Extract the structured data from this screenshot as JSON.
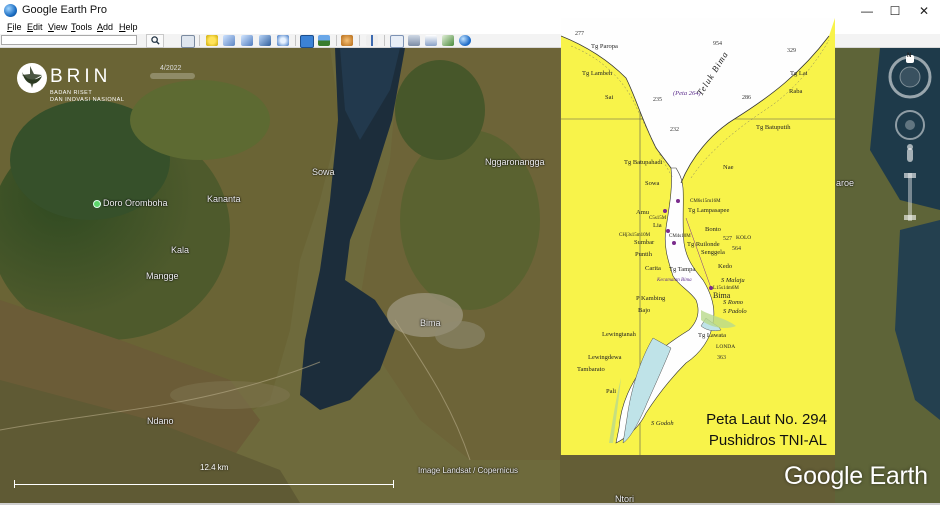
{
  "window": {
    "title": "Google Earth Pro",
    "minimize": "—",
    "maximize": "☐",
    "close": "✕"
  },
  "menu": [
    {
      "label": "File",
      "key": "F",
      "rest": "ile"
    },
    {
      "label": "Edit",
      "key": "E",
      "rest": "dit"
    },
    {
      "label": "View",
      "key": "V",
      "rest": "iew"
    },
    {
      "label": "Tools",
      "key": "T",
      "rest": "ools"
    },
    {
      "label": "Add",
      "key": "A",
      "rest": "dd"
    },
    {
      "label": "Help",
      "key": "H",
      "rest": "elp"
    }
  ],
  "search": {
    "value": "",
    "button_icon": "search-icon"
  },
  "toolbar_icons": [
    "sidebar-icon",
    "placemark-icon",
    "polygon-icon",
    "path-icon",
    "image-overlay-icon",
    "tour-icon",
    "historical-imagery-icon",
    "sun-icon",
    "planets-icon",
    "ruler-icon",
    "email-icon",
    "print-icon",
    "save-image-icon",
    "google-maps-icon",
    "earth-icon"
  ],
  "map": {
    "logo": {
      "name": "BRIN",
      "line1": "BADAN RISET",
      "line2": "DAN INOVASI NASIONAL"
    },
    "historical_date": "4/2022",
    "places": [
      {
        "id": "doro",
        "text": "Doro Oromboha"
      },
      {
        "id": "kananta",
        "text": "Kananta"
      },
      {
        "id": "kala",
        "text": "Kala"
      },
      {
        "id": "mangge",
        "text": "Mangge"
      },
      {
        "id": "sowa",
        "text": "Sowa"
      },
      {
        "id": "nggaronangga",
        "text": "Nggaronangga"
      },
      {
        "id": "bima",
        "text": "Bima"
      },
      {
        "id": "ndano",
        "text": "Ndano"
      },
      {
        "id": "karoe",
        "text": "aroe"
      },
      {
        "id": "ntori",
        "text": "Ntori"
      }
    ],
    "scale": "12.4 km",
    "attribution": "Image Landsat / Copernicus",
    "brand": "Google Earth"
  },
  "overlay": {
    "caption_line1": "Peta Laut No. 294",
    "caption_line2": "Pushidros TNI-AL",
    "labels": {
      "tg_paropa": "Tg Paropa",
      "tg_lambeh": "Tg Lambeh",
      "sai": "Sai",
      "peta264": "(Peta 264)",
      "teluk_bima": "Teluk Bima",
      "tg_lai": "Tg Lai",
      "raba": "Raba",
      "tg_batuputih": "Tg Batuputih",
      "tg_batupahadi": "Tg Batupahadi",
      "nae": "Nae",
      "sowa": "Sowa",
      "amu": "Amu",
      "tg_lampasapee": "Tg Lampasapee",
      "lia": "Lia",
      "bonto": "Bonto",
      "sumbar": "Sumbar",
      "kolo": "KOLO",
      "tg_ruilonde": "Tg Ruilonde",
      "senggela": "Senggela",
      "puntih": "Puntih",
      "carita": "Carita",
      "tg_tampa": "Tg Tampa",
      "kedo": "Kedo",
      "s_malaju": "S Malaju",
      "bima": "Bima",
      "p_kambing": "P Kambing",
      "bajo": "Bajo",
      "s_romo": "S Romo",
      "s_padolo": "S Padolo",
      "lewingtanah": "Lewingtanah",
      "tg_lawata": "Tg Lawata",
      "londa": "LONDA",
      "lewingdewa": "Lewingdewa",
      "tambarato": "Tambarato",
      "pali": "Pali",
      "s_godoh": "S Godoh",
      "cm6": "CM6s15m16M",
      "c5s15m": "C5s15M",
      "cm4": "CM4s10M",
      "chj": "CHj3s15m10M",
      "light_bima": "L15s14m6M",
      "lia_light": "Lia",
      "kecamatan": "Kecamatan Bima",
      "depth_954": "954",
      "depth_329": "329",
      "depth_277": "277",
      "depth_235": "235",
      "depth_286": "286",
      "depth_232": "232",
      "depth_527": "527",
      "depth_564": "564",
      "depth_363": "363"
    }
  }
}
